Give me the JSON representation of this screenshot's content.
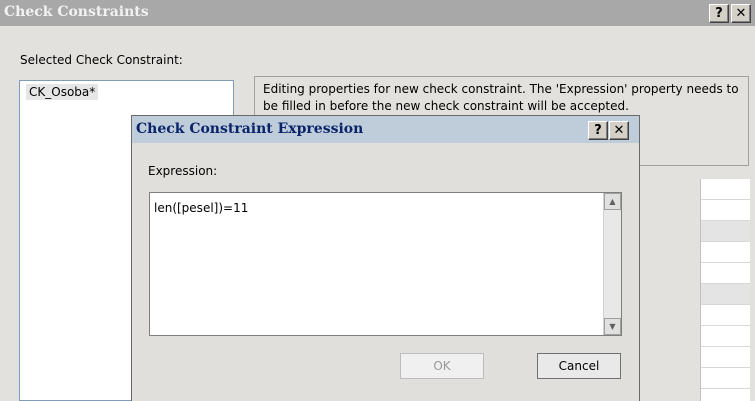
{
  "outer_dialog": {
    "title": "Check Constraints",
    "help_button": "?",
    "close_button": "✕",
    "selected_label": "Selected Check Constraint:",
    "constraints": [
      "CK_Osoba*"
    ],
    "info_text": "Editing properties for new check constraint.  The 'Expression' property needs to be filled in before the new check constraint will be accepted."
  },
  "expression_dialog": {
    "title": "Check Constraint Expression",
    "help_button": "?",
    "close_button": "✕",
    "expression_label": "Expression:",
    "expression_value": "len([pesel])=11",
    "ok_label": "OK",
    "cancel_label": "Cancel"
  },
  "icons": {
    "scroll_up": "▲",
    "scroll_down": "▼"
  }
}
